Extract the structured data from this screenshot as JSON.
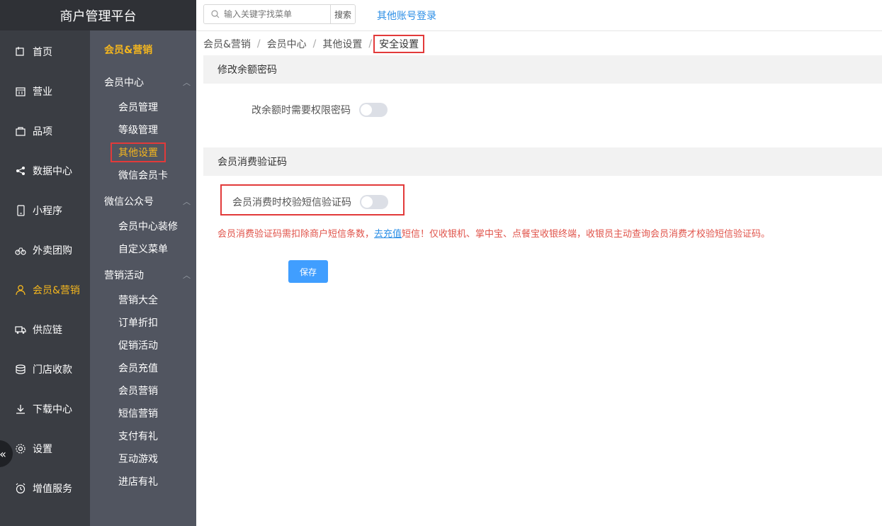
{
  "brand": {
    "title": "商户管理平台"
  },
  "topbar": {
    "search_placeholder": "输入关键字找菜单",
    "search_button": "搜索",
    "other_login": "其他账号登录"
  },
  "nav": {
    "items": [
      {
        "label": "首页",
        "icon": "home-icon"
      },
      {
        "label": "营业",
        "icon": "calendar-icon"
      },
      {
        "label": "品项",
        "icon": "bag-icon"
      },
      {
        "label": "数据中心",
        "icon": "share-icon"
      },
      {
        "label": "小程序",
        "icon": "phone-icon"
      },
      {
        "label": "外卖团购",
        "icon": "bike-icon"
      },
      {
        "label": "会员&营销",
        "icon": "user-icon"
      },
      {
        "label": "供应链",
        "icon": "truck-icon"
      },
      {
        "label": "门店收款",
        "icon": "coins-icon"
      },
      {
        "label": "下载中心",
        "icon": "download-icon"
      },
      {
        "label": "设置",
        "icon": "gear-icon"
      },
      {
        "label": "增值服务",
        "icon": "alarm-icon"
      }
    ],
    "active_color": "#f4b61e"
  },
  "subnav": {
    "head": "会员&营销",
    "groups": [
      {
        "label": "会员中心",
        "links": [
          "会员管理",
          "等级管理",
          "其他设置",
          "微信会员卡"
        ]
      },
      {
        "label": "微信公众号",
        "links": [
          "会员中心装修",
          "自定义菜单"
        ]
      },
      {
        "label": "营销活动",
        "links": [
          "营销大全",
          "订单折扣",
          "促销活动",
          "会员充值",
          "会员营销",
          "短信营销",
          "支付有礼",
          "互动游戏",
          "进店有礼"
        ]
      }
    ]
  },
  "breadcrumb": [
    "会员&营销",
    "会员中心",
    "其他设置",
    "安全设置"
  ],
  "sections": {
    "balance": {
      "title": "修改余额密码",
      "row_label": "改余额时需要权限密码",
      "enabled": false
    },
    "sms": {
      "title": "会员消费验证码",
      "row_label": "会员消费时校验短信验证码",
      "enabled": false
    }
  },
  "notice": {
    "before": "会员消费验证码需扣除商户短信条数，",
    "link": "去充值",
    "after": "短信！仅收银机、掌中宝、点餐宝收银终端，收银员主动查询会员消费才校验短信验证码。"
  },
  "save_label": "保存",
  "colors": {
    "accent": "#409eff",
    "danger": "#e23a3a",
    "warning_text": "#e0534a"
  }
}
